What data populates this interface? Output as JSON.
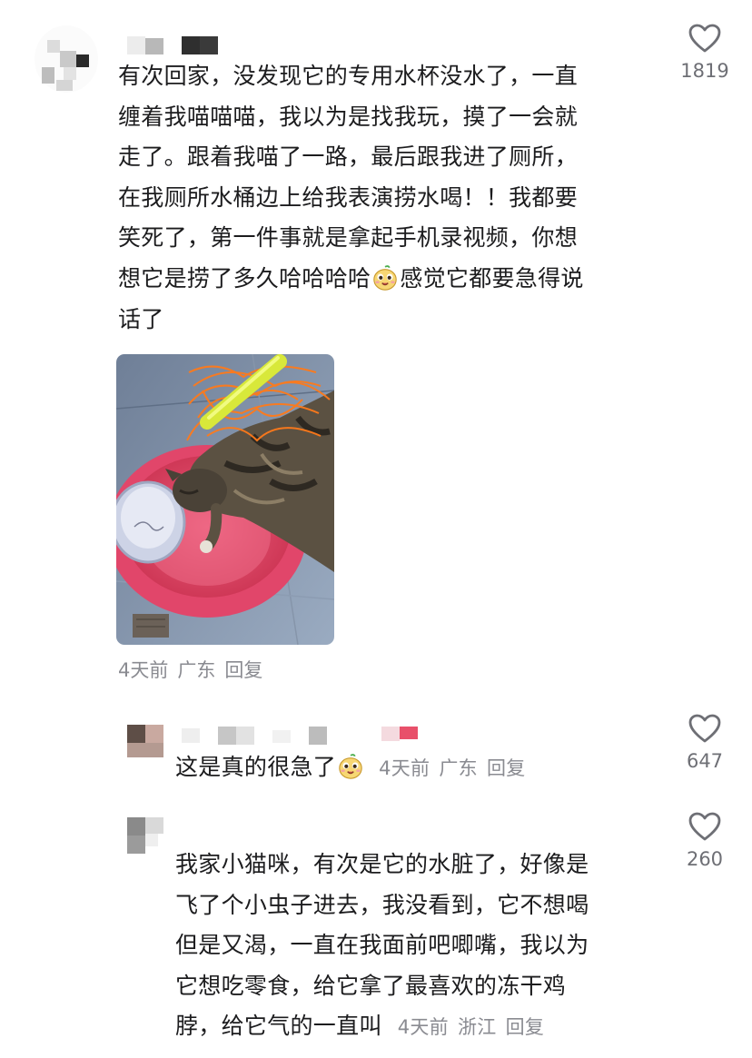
{
  "main_comment": {
    "text_before_emoji": "有次回家，没发现它的专用水杯没水了，一直缠着我喵喵喵，我以为是找我玩，摸了一会就走了。跟着我喵了一路，最后跟我进了厕所，在我厕所水桶边上给我表演捞水喝！！我都要笑死了，第一件事就是拿起手机录视频，你想想它是捞了多久哈哈哈哈",
    "lines": [
      "有次回家，没发现它的专用水杯没水了，一直",
      "缠着我喵喵喵，我以为是找我玩，摸了一会就",
      "走了。跟着我喵了一路，最后跟我进了厕所，",
      "在我厕所水桶边上给我表演捞水喝！！我都要",
      "笑死了，第一件事就是拿起手机录视频，你想",
      "想它是捞了多久哈哈哈哈",
      "话了"
    ],
    "line6_after_emoji": "感觉它都要急得说",
    "emoji_icon": "smug-face-emoji",
    "photo_icon": "cat-photo",
    "time": "4天前",
    "location": "广东",
    "reply_label": "回复",
    "like_count": "1819"
  },
  "replies": [
    {
      "text": "这是真的很急了",
      "emoji_icon": "smug-face-emoji",
      "time": "4天前",
      "location": "广东",
      "reply_label": "回复",
      "like_count": "647"
    },
    {
      "lines": [
        "我家小猫咪，有次是它的水脏了，好像是",
        "飞了个小虫子进去，我没看到，它不想喝",
        "但是又渴，一直在我面前吧唧嘴，我以为",
        "它想吃零食，给它拿了最喜欢的冻干鸡",
        "脖，给它气的一直叫"
      ],
      "time": "4天前",
      "location": "浙江",
      "reply_label": "回复",
      "like_count": "260"
    }
  ],
  "colors": {
    "text": "#1c1c1e",
    "meta": "#8a8b91",
    "like_icon": "#6e6f75",
    "mosaic_accent": "#e8506a"
  }
}
